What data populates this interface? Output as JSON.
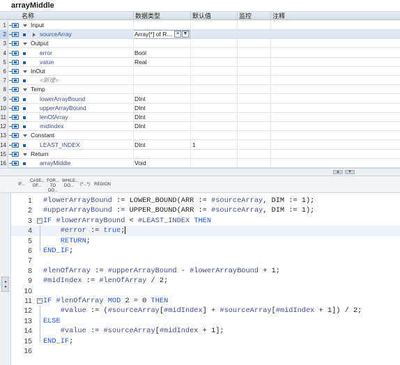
{
  "window": {
    "title": "arrayMiddle"
  },
  "table": {
    "columns": [
      "名称",
      "数据类型",
      "默认值",
      "监控",
      "注释"
    ],
    "rows": [
      {
        "num": "1",
        "kind": "section",
        "name": "Input",
        "type": "",
        "default": ""
      },
      {
        "num": "2",
        "kind": "var",
        "name": "sourceArray",
        "type": "Array[*] of R...",
        "default": "",
        "selected": true
      },
      {
        "num": "3",
        "kind": "section",
        "name": "Output",
        "type": "",
        "default": ""
      },
      {
        "num": "4",
        "kind": "var",
        "name": "error",
        "type": "Bool",
        "default": ""
      },
      {
        "num": "5",
        "kind": "var",
        "name": "value",
        "type": "Real",
        "default": ""
      },
      {
        "num": "6",
        "kind": "section",
        "name": "InOut",
        "type": "",
        "default": ""
      },
      {
        "num": "7",
        "kind": "placeholder",
        "name": "<新增>",
        "type": "",
        "default": ""
      },
      {
        "num": "8",
        "kind": "section",
        "name": "Temp",
        "type": "",
        "default": ""
      },
      {
        "num": "9",
        "kind": "var",
        "name": "lowerArrayBound",
        "type": "DInt",
        "default": ""
      },
      {
        "num": "10",
        "kind": "var",
        "name": "upperArrayBound",
        "type": "DInt",
        "default": ""
      },
      {
        "num": "11",
        "kind": "var",
        "name": "lenOfArray",
        "type": "DInt",
        "default": ""
      },
      {
        "num": "12",
        "kind": "var",
        "name": "midIndex",
        "type": "DInt",
        "default": ""
      },
      {
        "num": "13",
        "kind": "section",
        "name": "Constant",
        "type": "",
        "default": ""
      },
      {
        "num": "14",
        "kind": "var",
        "name": "LEAST_INDEX",
        "type": "DInt",
        "default": "1"
      },
      {
        "num": "15",
        "kind": "section",
        "name": "Return",
        "type": "",
        "default": ""
      },
      {
        "num": "16",
        "kind": "var",
        "name": "arrayMiddle",
        "type": "Void",
        "default": ""
      }
    ]
  },
  "toolbar": {
    "buttons": [
      "IF...",
      "CASE... OF...",
      "FOR... TO DO...",
      "WHILE... DO...",
      "(*...*)",
      "REGION"
    ]
  },
  "code": {
    "lines": [
      {
        "num": "1",
        "text": "#lowerArrayBound := LOWER_BOUND(ARR := #sourceArray, DIM := 1);"
      },
      {
        "num": "2",
        "text": "#upperArrayBound := UPPER_BOUND(ARR := #sourceArray, DIM := 1);"
      },
      {
        "num": "3",
        "text": "IF #lowerArrayBound < #LEAST_INDEX THEN",
        "fold": "start"
      },
      {
        "num": "4",
        "text": "    #error := true;",
        "fold": "mid",
        "current": true
      },
      {
        "num": "5",
        "text": "    RETURN;",
        "fold": "mid"
      },
      {
        "num": "6",
        "text": "END_IF;",
        "fold": "end"
      },
      {
        "num": "7",
        "text": ""
      },
      {
        "num": "8",
        "text": "#lenOfArray := #upperArrayBound - #lowerArrayBound + 1;"
      },
      {
        "num": "9",
        "text": "#midIndex := #lenOfArray / 2;"
      },
      {
        "num": "10",
        "text": ""
      },
      {
        "num": "11",
        "text": "IF #lenOfArray MOD 2 = 0 THEN",
        "fold": "start"
      },
      {
        "num": "12",
        "text": "    #value := (#sourceArray[#midIndex] + #sourceArray[#midIndex + 1]) / 2;",
        "fold": "mid"
      },
      {
        "num": "13",
        "text": "ELSE",
        "fold": "mid"
      },
      {
        "num": "14",
        "text": "    #value := #sourceArray[#midIndex + 1];",
        "fold": "mid"
      },
      {
        "num": "15",
        "text": "END_IF;",
        "fold": "end"
      },
      {
        "num": "16",
        "text": ""
      }
    ]
  },
  "keywords": [
    "IF",
    "THEN",
    "ELSE",
    "END_IF",
    "RETURN",
    "MOD",
    "true"
  ],
  "colors": {
    "keyword": "#1e5bd6",
    "variable": "#3f4f8f",
    "selected_row": "#dfe9f5"
  }
}
